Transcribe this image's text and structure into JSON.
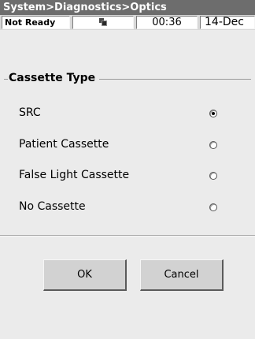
{
  "window": {
    "breadcrumb": "System>Diagnostics>Optics"
  },
  "status_bar": {
    "status": "Not Ready",
    "icon": "network-icon",
    "time": "00:36",
    "date": "14-Dec"
  },
  "cassette_group": {
    "title": "Cassette Type",
    "options": [
      {
        "label": "SRC",
        "selected": true
      },
      {
        "label": "Patient Cassette",
        "selected": false
      },
      {
        "label": "False Light Cassette",
        "selected": false
      },
      {
        "label": "No Cassette",
        "selected": false
      }
    ]
  },
  "buttons": {
    "ok": "OK",
    "cancel": "Cancel"
  }
}
